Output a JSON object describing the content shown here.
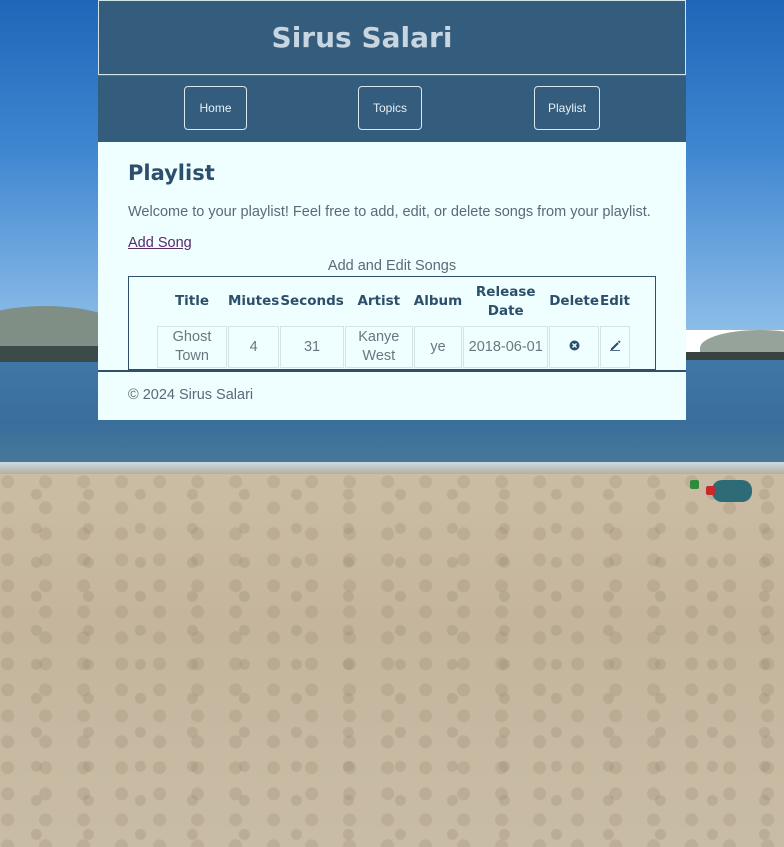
{
  "header": {
    "site_title": "Sirus Salari"
  },
  "nav": {
    "items": [
      {
        "label": "Home"
      },
      {
        "label": "Topics"
      },
      {
        "label": "Playlist"
      }
    ]
  },
  "main": {
    "title": "Playlist",
    "intro": "Welcome to your playlist! Feel free to add, edit, or delete songs from your playlist.",
    "add_link": "Add Song",
    "table_caption": "Add and Edit Songs",
    "columns": [
      "Title",
      "Miutes",
      "Seconds",
      "Artist",
      "Album",
      "Release Date",
      "Delete",
      "Edit"
    ],
    "rows": [
      {
        "title": "Ghost Town",
        "minutes": "4",
        "seconds": "31",
        "artist": "Kanye West",
        "album": "ye",
        "release_date": "2018-06-01",
        "delete_icon": "x-circle-icon",
        "edit_icon": "pencil-icon"
      }
    ]
  },
  "footer": {
    "text": "© 2024 Sirus Salari"
  },
  "colors": {
    "header_bg": "#335c7d",
    "content_bg": "#effefe",
    "title_text": "#2c4f6b",
    "link": "#5a2a6a"
  }
}
